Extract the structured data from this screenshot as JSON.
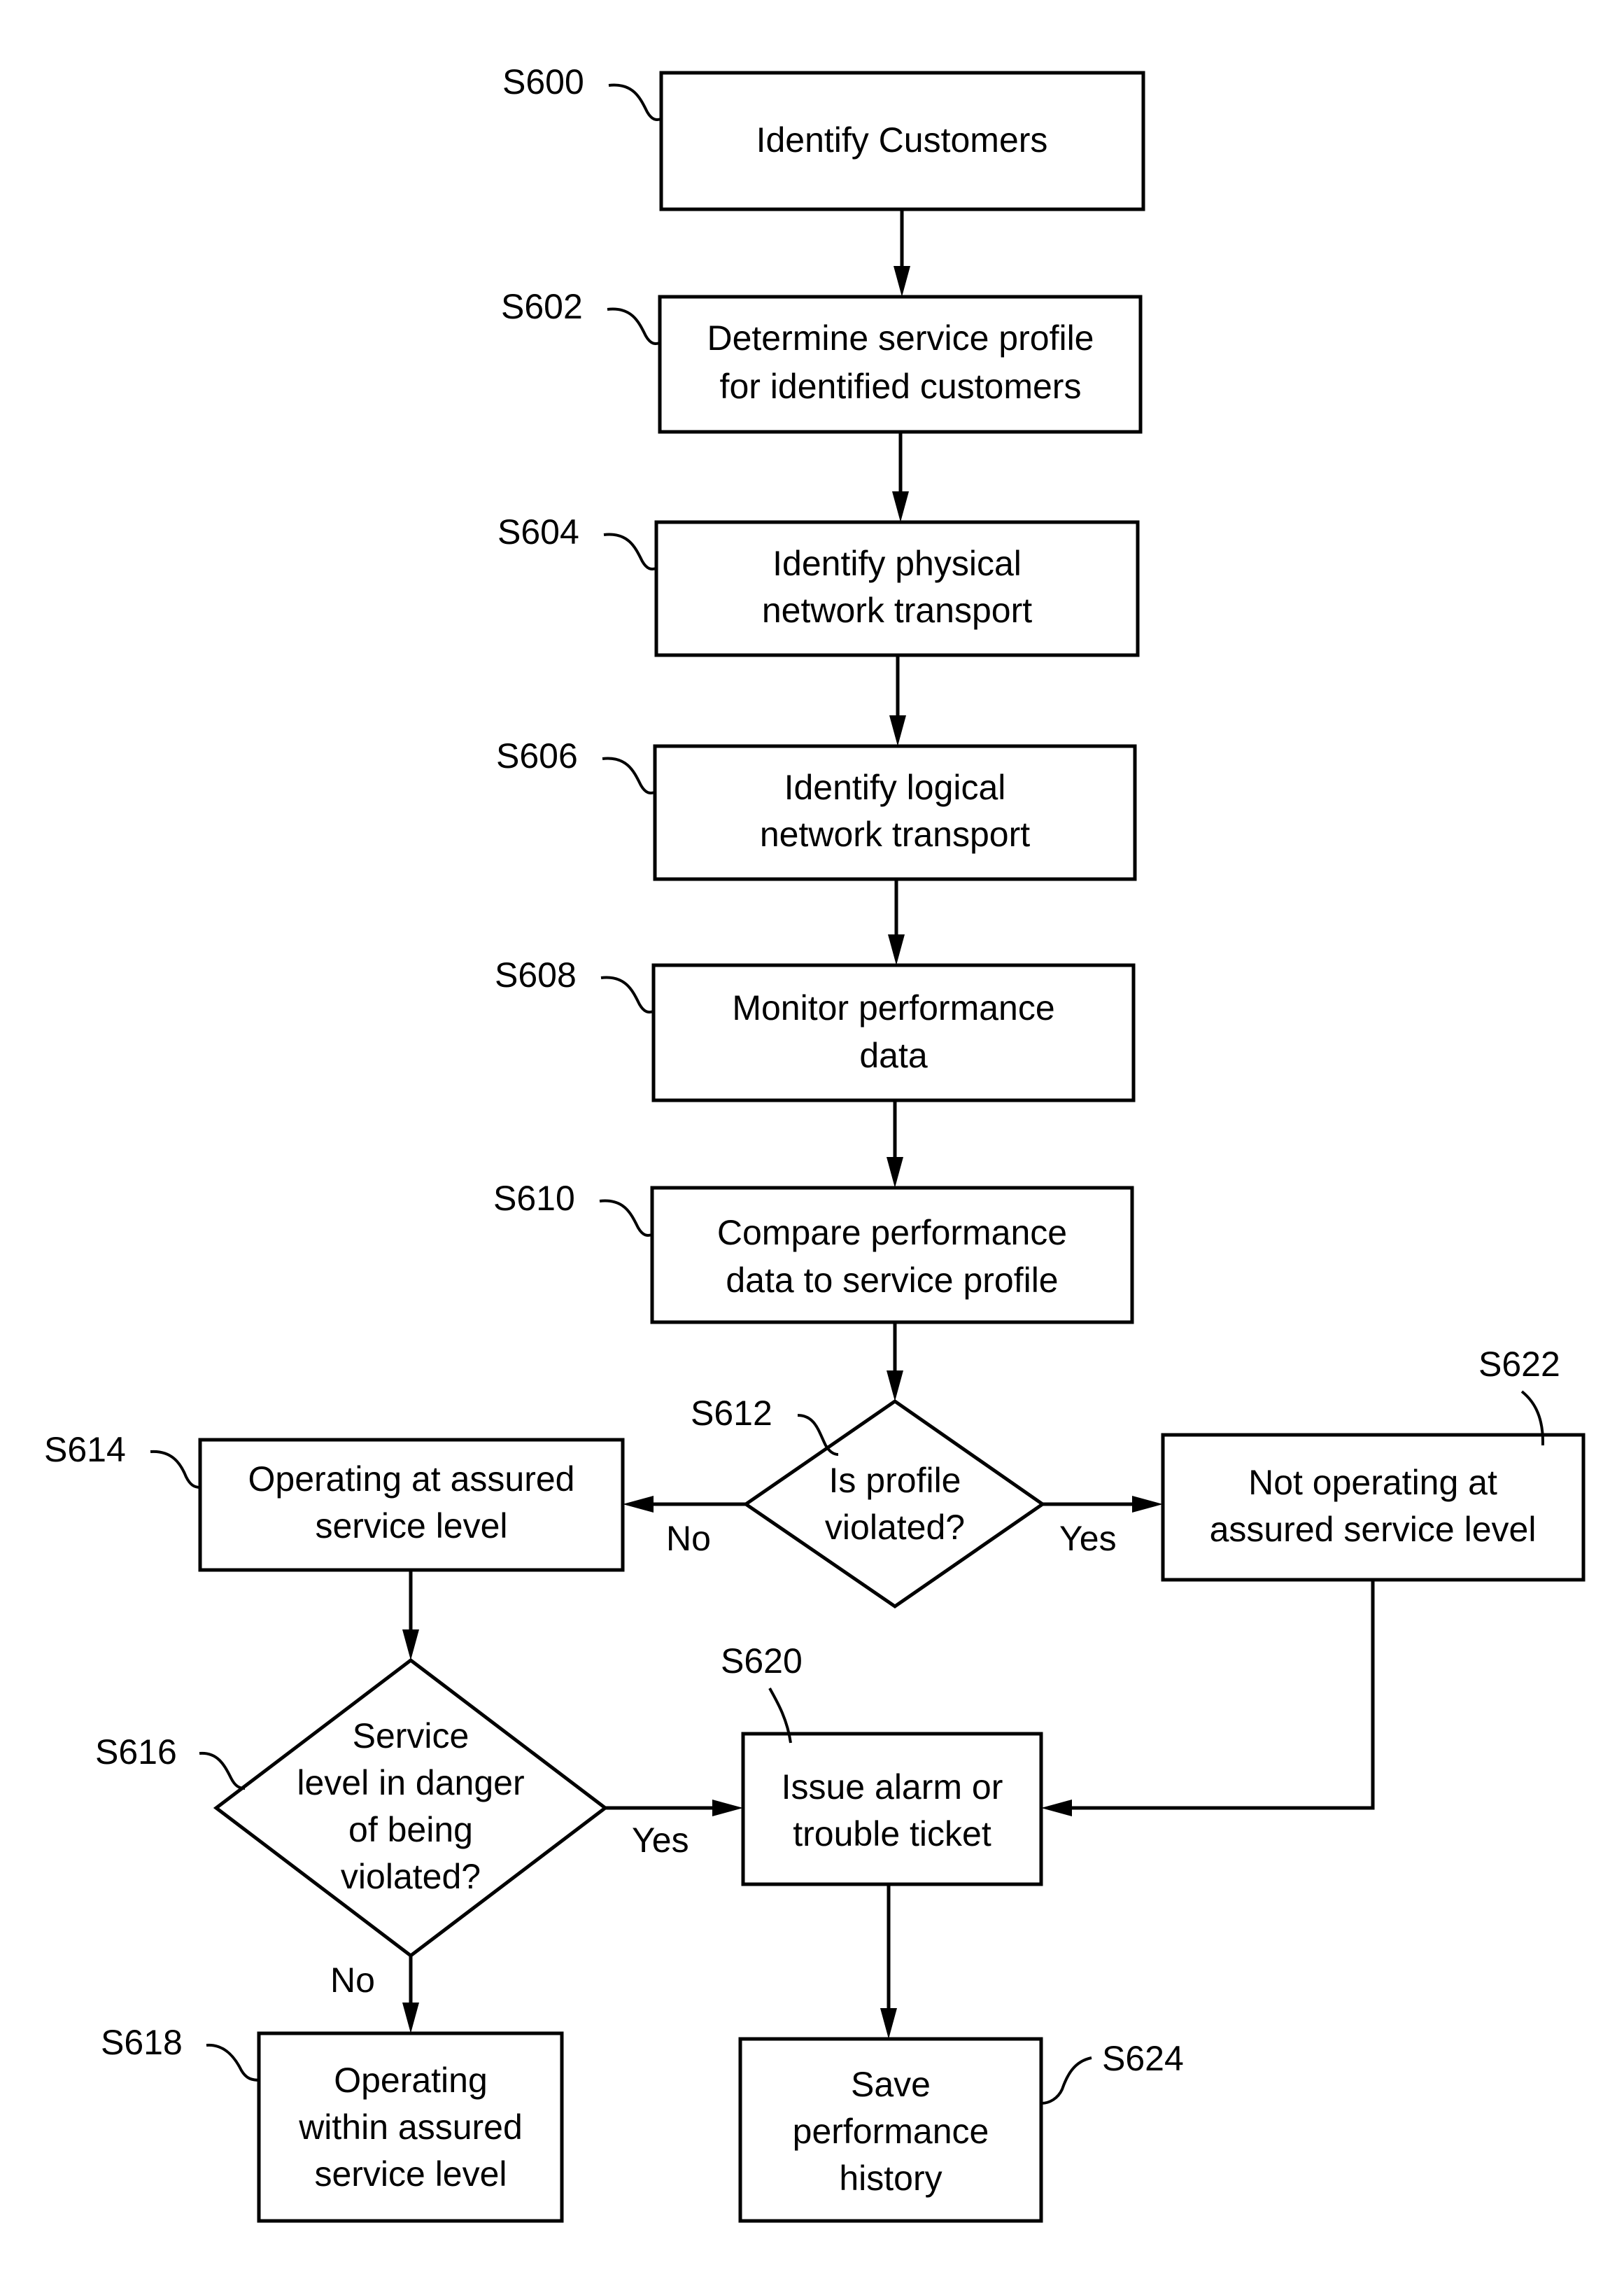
{
  "diagram": {
    "type": "flowchart",
    "steps": {
      "s600": {
        "id": "S600",
        "lines": [
          "Identify Customers"
        ]
      },
      "s602": {
        "id": "S602",
        "lines": [
          "Determine service profile",
          "for identified customers"
        ]
      },
      "s604": {
        "id": "S604",
        "lines": [
          "Identify physical",
          "network transport"
        ]
      },
      "s606": {
        "id": "S606",
        "lines": [
          "Identify logical",
          "network transport"
        ]
      },
      "s608": {
        "id": "S608",
        "lines": [
          "Monitor performance",
          "data"
        ]
      },
      "s610": {
        "id": "S610",
        "lines": [
          "Compare performance",
          "data to service profile"
        ]
      },
      "s612": {
        "id": "S612",
        "lines": [
          "Is profile",
          "violated?"
        ]
      },
      "s614": {
        "id": "S614",
        "lines": [
          "Operating at assured",
          "service level"
        ]
      },
      "s616": {
        "id": "S616",
        "lines": [
          "Service",
          "level in danger",
          "of being",
          "violated?"
        ]
      },
      "s618": {
        "id": "S618",
        "lines": [
          "Operating",
          "within assured",
          "service level"
        ]
      },
      "s620": {
        "id": "S620",
        "lines": [
          "Issue alarm or",
          "trouble ticket"
        ]
      },
      "s622": {
        "id": "S622",
        "lines": [
          "Not operating at",
          "assured service level"
        ]
      },
      "s624": {
        "id": "S624",
        "lines": [
          "Save",
          "performance",
          "history"
        ]
      }
    },
    "edge_labels": {
      "s612_no": "No",
      "s612_yes": "Yes",
      "s616_yes": "Yes",
      "s616_no": "No"
    },
    "edges": [
      {
        "from": "S600",
        "to": "S602"
      },
      {
        "from": "S602",
        "to": "S604"
      },
      {
        "from": "S604",
        "to": "S606"
      },
      {
        "from": "S606",
        "to": "S608"
      },
      {
        "from": "S608",
        "to": "S610"
      },
      {
        "from": "S610",
        "to": "S612"
      },
      {
        "from": "S612",
        "to": "S614",
        "label": "No"
      },
      {
        "from": "S612",
        "to": "S622",
        "label": "Yes"
      },
      {
        "from": "S614",
        "to": "S616"
      },
      {
        "from": "S616",
        "to": "S620",
        "label": "Yes"
      },
      {
        "from": "S616",
        "to": "S618",
        "label": "No"
      },
      {
        "from": "S622",
        "to": "S620"
      },
      {
        "from": "S620",
        "to": "S624"
      }
    ]
  }
}
